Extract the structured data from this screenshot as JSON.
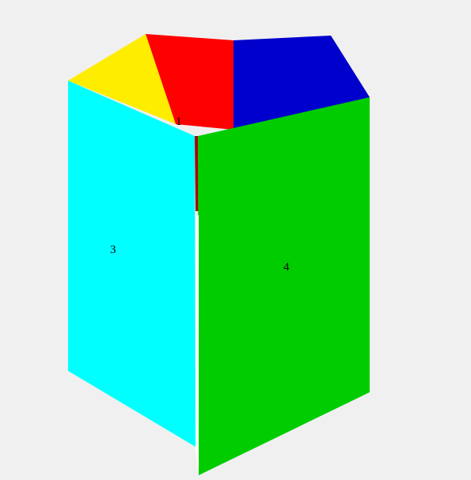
{
  "diagram": {
    "faces": {
      "top_yellow": {
        "label": null
      },
      "top_red": {
        "label": "1"
      },
      "top_blue": {
        "label": null
      },
      "side_cyan": {
        "label": "3"
      },
      "side_green": {
        "label": "4"
      }
    },
    "colors": {
      "yellow": "#ffed00",
      "red": "#ff0000",
      "blue": "#0000cc",
      "cyan": "#00ffff",
      "green": "#00cc00",
      "edge_dark_red": "#aa0000",
      "edge_white": "#ffffff",
      "bg": "#f0f0f0"
    }
  }
}
